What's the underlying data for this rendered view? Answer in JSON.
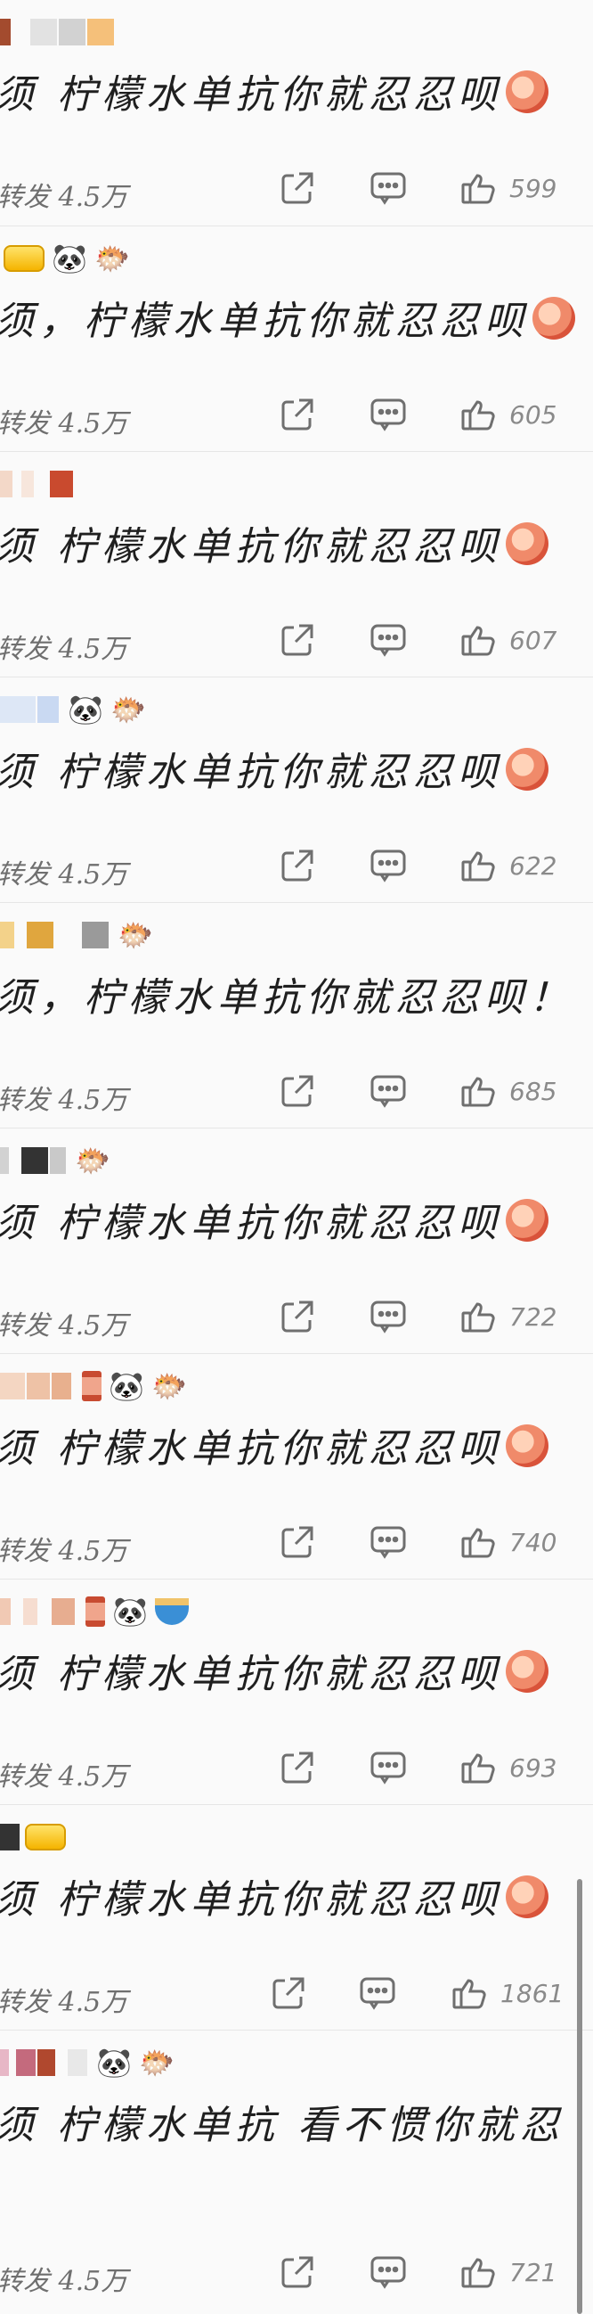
{
  "posts": [
    {
      "text": "须 柠檬水单抗你就忍忍呗",
      "source": "转发 4.5万",
      "likes": "599"
    },
    {
      "text": "须，柠檬水单抗你就忍忍呗",
      "source": "转发 4.5万",
      "likes": "605"
    },
    {
      "text": "须 柠檬水单抗你就忍忍呗",
      "source": "转发 4.5万",
      "likes": "607"
    },
    {
      "text": "须 柠檬水单抗你就忍忍呗",
      "source": "转发 4.5万",
      "likes": "622"
    },
    {
      "text": "须，柠檬水单抗你就忍忍呗！",
      "source": "转发 4.5万",
      "likes": "685"
    },
    {
      "text": "须 柠檬水单抗你就忍忍呗",
      "source": "转发 4.5万",
      "likes": "722"
    },
    {
      "text": "须 柠檬水单抗你就忍忍呗",
      "source": "转发 4.5万",
      "likes": "740"
    },
    {
      "text": "须 柠檬水单抗你就忍忍呗",
      "source": "转发 4.5万",
      "likes": "693"
    },
    {
      "text": "须 柠檬水单抗你就忍忍呗",
      "source": "转发 4.5万",
      "likes": "1861"
    },
    {
      "text": "须 柠檬水单抗 看不惯你就忍",
      "source": "转发 4.5万",
      "likes": "721"
    }
  ],
  "icons": {
    "share": "share-icon",
    "comment": "comment-icon",
    "like": "thumbs-up-icon"
  },
  "colors": {
    "background": "#fafafa",
    "divider": "#e6e6e6",
    "icon": "#6f6f6f"
  }
}
